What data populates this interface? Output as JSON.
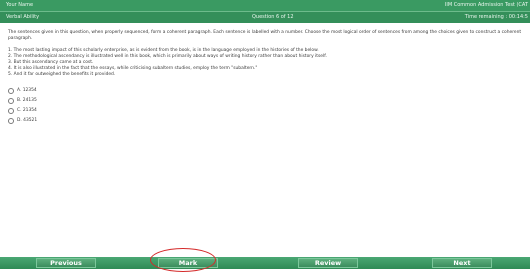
{
  "header": {
    "candidate_name": "Your Name",
    "exam_title": "IIM Common Admission Test (CAT",
    "section": "Verbal Ability",
    "question_counter": "Question 6 of 12",
    "time_remaining_label": "Time remaining : 00:14:5"
  },
  "question": {
    "instruction": "The sentences given in this question, when properly sequenced, form a coherent paragraph. Each sentence is labelled with a number. Choose the most logical order of sentences from among the choices given to construct a coherent paragraph.",
    "sentences": [
      "1. The most lasting impact of this scholarly enterprise, as is evident from the book, is in the language employed in the histories of the below.",
      "2. The methodological ascendancy is illustrated well in this book, which is primarily about ways of writing history rather than about history itself.",
      "3. But this ascendancy came at a cost.",
      "4. It is also illustrated in the fact that the essays, while criticising subaltern studies, employ the term \"subaltern.\"",
      "5. And it far outweighed the benefits it provided."
    ],
    "options": [
      "A. 12354",
      "B. 24135",
      "C. 21354",
      "D. 43521"
    ]
  },
  "footer": {
    "previous_label": "Previous",
    "mark_label": "Mark",
    "review_label": "Review",
    "next_label": "Next"
  },
  "colors": {
    "header_green": "#3a9a62",
    "footer_green": "#2f8a55",
    "annotation_red": "#d42a2a"
  }
}
